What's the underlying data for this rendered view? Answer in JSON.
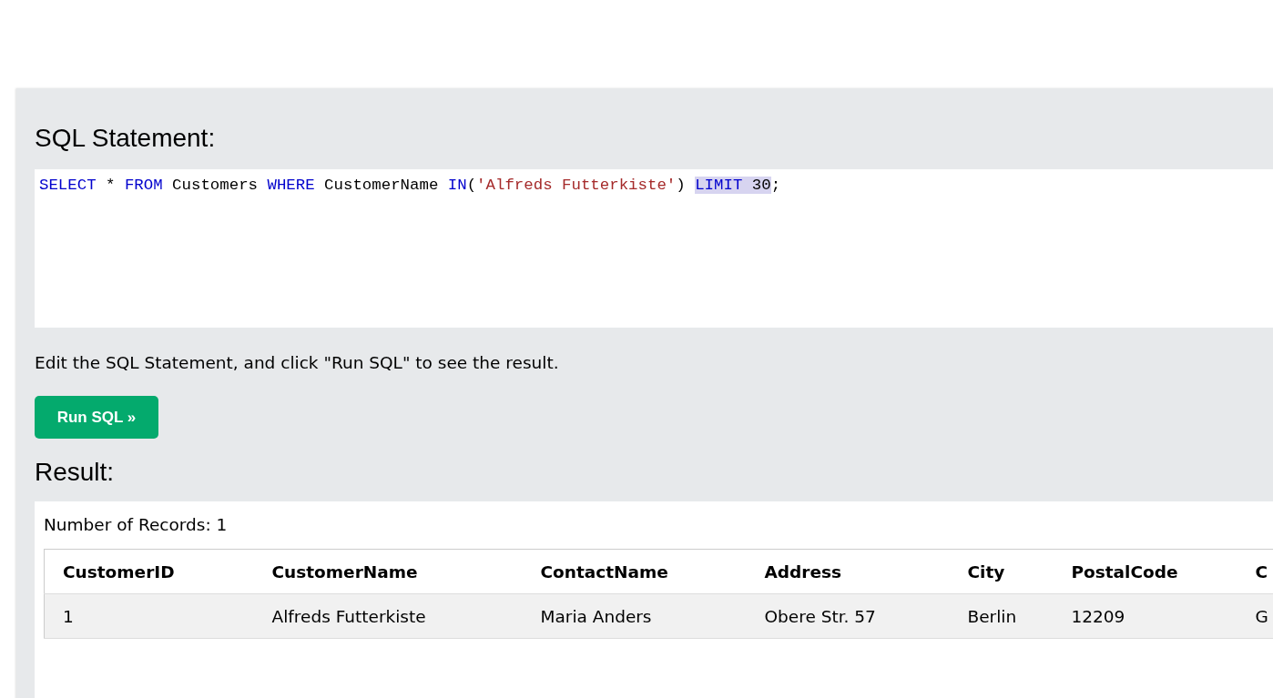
{
  "sql_panel": {
    "heading": "SQL Statement:",
    "code_tokens": [
      {
        "text": "SELECT",
        "kind": "keyword",
        "highlighted": false
      },
      {
        "text": " * ",
        "kind": "plain",
        "highlighted": false
      },
      {
        "text": "FROM",
        "kind": "keyword",
        "highlighted": false
      },
      {
        "text": " Customers ",
        "kind": "plain",
        "highlighted": false
      },
      {
        "text": "WHERE",
        "kind": "keyword",
        "highlighted": false
      },
      {
        "text": " CustomerName ",
        "kind": "plain",
        "highlighted": false
      },
      {
        "text": "IN",
        "kind": "keyword",
        "highlighted": false
      },
      {
        "text": "(",
        "kind": "plain",
        "highlighted": false
      },
      {
        "text": "'Alfreds Futterkiste'",
        "kind": "string",
        "highlighted": false
      },
      {
        "text": ") ",
        "kind": "plain",
        "highlighted": false
      },
      {
        "text": "LIMIT",
        "kind": "keyword",
        "highlighted": true
      },
      {
        "text": " 30",
        "kind": "plain",
        "highlighted": true
      },
      {
        "text": ";",
        "kind": "plain",
        "highlighted": false
      }
    ],
    "hint": "Edit the SQL Statement, and click \"Run SQL\" to see the result.",
    "run_button": "Run SQL »"
  },
  "result": {
    "heading": "Result:",
    "record_count": "Number of Records: 1",
    "table": {
      "columns": [
        "CustomerID",
        "CustomerName",
        "ContactName",
        "Address",
        "City",
        "PostalCode",
        "C"
      ],
      "rows": [
        [
          "1",
          "Alfreds Futterkiste",
          "Maria Anders",
          "Obere Str. 57",
          "Berlin",
          "12209",
          "G"
        ]
      ]
    }
  }
}
